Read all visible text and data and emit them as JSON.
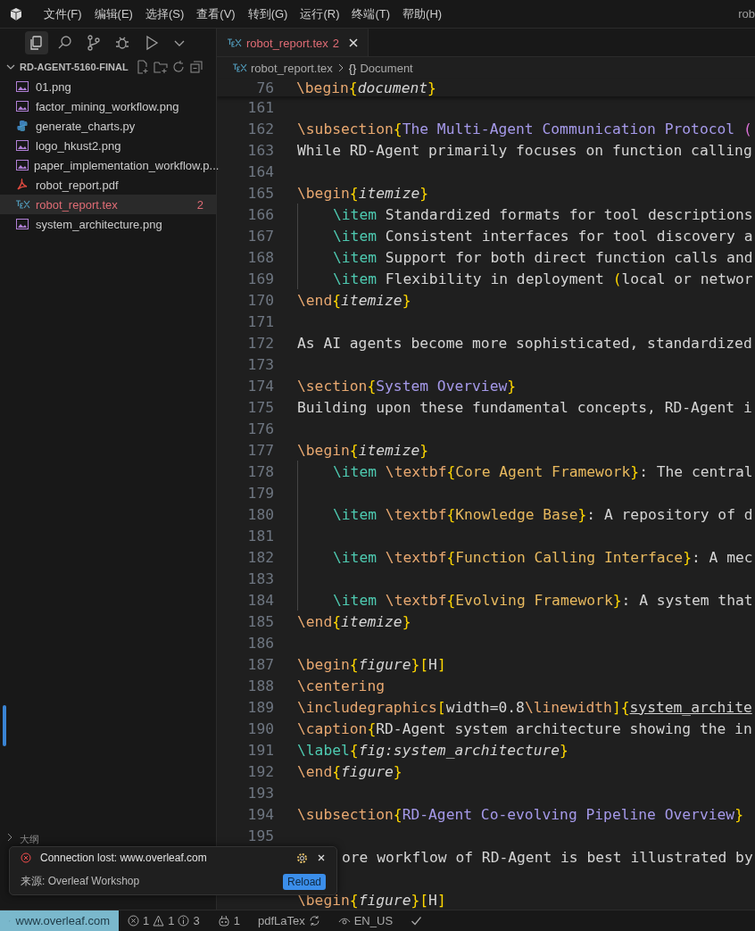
{
  "menu": [
    "文件(F)",
    "编辑(E)",
    "选择(S)",
    "查看(V)",
    "转到(G)",
    "运行(R)",
    "终端(T)",
    "帮助(H)"
  ],
  "window": {
    "title": "rob"
  },
  "activity": [
    {
      "kind": "explorer",
      "selected": true
    },
    {
      "kind": "search",
      "selected": false
    },
    {
      "kind": "source-control",
      "selected": false
    },
    {
      "kind": "debug",
      "selected": false
    },
    {
      "kind": "run",
      "selected": false
    },
    {
      "kind": "more",
      "selected": false
    }
  ],
  "explorer": {
    "folder": "RD-AGENT-5160-FINAL",
    "expanded": true,
    "files": [
      {
        "name": "01.png",
        "kind": "image",
        "selected": false,
        "error": false
      },
      {
        "name": "factor_mining_workflow.png",
        "kind": "image",
        "selected": false,
        "error": false
      },
      {
        "name": "generate_charts.py",
        "kind": "python",
        "selected": false,
        "error": false
      },
      {
        "name": "logo_hkust2.png",
        "kind": "image",
        "selected": false,
        "error": false
      },
      {
        "name": "paper_implementation_workflow.p...",
        "kind": "image",
        "selected": false,
        "error": false
      },
      {
        "name": "robot_report.pdf",
        "kind": "pdf",
        "selected": false,
        "error": false
      },
      {
        "name": "robot_report.tex",
        "kind": "tex",
        "selected": true,
        "error": true,
        "badge": "2"
      },
      {
        "name": "system_architecture.png",
        "kind": "image",
        "selected": false,
        "error": false
      }
    ],
    "outline": "大纲"
  },
  "tab": {
    "name": "robot_report.tex",
    "badge": "2",
    "selected": true,
    "error": true
  },
  "breadcrumb": {
    "file": "robot_report.tex",
    "symbol": "{}",
    "section": "Document"
  },
  "sticky_line": {
    "number": "76",
    "segments": [
      {
        "kind": "cmd",
        "text": "\\begin"
      },
      {
        "kind": "brace",
        "text": "{"
      },
      {
        "kind": "env",
        "text": "document"
      },
      {
        "kind": "brace",
        "text": "}"
      }
    ]
  },
  "lines": [
    {
      "number": "161",
      "indent": false
    },
    {
      "number": "162",
      "indent": false,
      "segments": [
        {
          "kind": "cmd",
          "text": "\\subsection"
        },
        {
          "kind": "brace",
          "text": "{"
        },
        {
          "kind": "title",
          "text": "The Multi-Agent Communication Protocol "
        },
        {
          "kind": "brace2",
          "text": "("
        }
      ]
    },
    {
      "number": "163",
      "indent": false,
      "segments": [
        {
          "kind": "text",
          "text": "While RD-Agent primarily focuses on function calling"
        }
      ]
    },
    {
      "number": "164",
      "indent": false
    },
    {
      "number": "165",
      "indent": false,
      "segments": [
        {
          "kind": "cmd",
          "text": "\\begin"
        },
        {
          "kind": "brace",
          "text": "{"
        },
        {
          "kind": "env",
          "text": "itemize"
        },
        {
          "kind": "brace",
          "text": "}"
        }
      ]
    },
    {
      "number": "166",
      "indent": true,
      "segments": [
        {
          "kind": "item",
          "text": "\\item"
        },
        {
          "kind": "text",
          "text": " Standardized formats for tool descriptions"
        }
      ]
    },
    {
      "number": "167",
      "indent": true,
      "segments": [
        {
          "kind": "item",
          "text": "\\item"
        },
        {
          "kind": "text",
          "text": " Consistent interfaces for tool discovery a"
        }
      ]
    },
    {
      "number": "168",
      "indent": true,
      "segments": [
        {
          "kind": "item",
          "text": "\\item"
        },
        {
          "kind": "text",
          "text": " Support for both direct function calls and"
        }
      ]
    },
    {
      "number": "169",
      "indent": true,
      "segments": [
        {
          "kind": "item",
          "text": "\\item"
        },
        {
          "kind": "text",
          "text": " Flexibility in deployment "
        },
        {
          "kind": "brace",
          "text": "("
        },
        {
          "kind": "text",
          "text": "local or networ"
        }
      ]
    },
    {
      "number": "170",
      "indent": false,
      "segments": [
        {
          "kind": "cmd",
          "text": "\\end"
        },
        {
          "kind": "brace",
          "text": "{"
        },
        {
          "kind": "env",
          "text": "itemize"
        },
        {
          "kind": "brace",
          "text": "}"
        }
      ]
    },
    {
      "number": "171",
      "indent": false
    },
    {
      "number": "172",
      "indent": false,
      "segments": [
        {
          "kind": "text",
          "text": "As AI agents become more sophisticated, standardized"
        }
      ]
    },
    {
      "number": "173",
      "indent": false
    },
    {
      "number": "174",
      "indent": false,
      "segments": [
        {
          "kind": "cmd",
          "text": "\\section"
        },
        {
          "kind": "brace",
          "text": "{"
        },
        {
          "kind": "title",
          "text": "System Overview"
        },
        {
          "kind": "brace",
          "text": "}"
        }
      ]
    },
    {
      "number": "175",
      "indent": false,
      "segments": [
        {
          "kind": "text",
          "text": "Building upon these fundamental concepts, RD-Agent i"
        }
      ]
    },
    {
      "number": "176",
      "indent": false
    },
    {
      "number": "177",
      "indent": false,
      "segments": [
        {
          "kind": "cmd",
          "text": "\\begin"
        },
        {
          "kind": "brace",
          "text": "{"
        },
        {
          "kind": "env",
          "text": "itemize"
        },
        {
          "kind": "brace",
          "text": "}"
        }
      ]
    },
    {
      "number": "178",
      "indent": true,
      "segments": [
        {
          "kind": "item",
          "text": "\\item "
        },
        {
          "kind": "cmd",
          "text": "\\textbf"
        },
        {
          "kind": "brace",
          "text": "{"
        },
        {
          "kind": "bold",
          "text": "Core Agent Framework"
        },
        {
          "kind": "brace",
          "text": "}"
        },
        {
          "kind": "text",
          "text": ": The central"
        }
      ]
    },
    {
      "number": "179",
      "indent": true
    },
    {
      "number": "180",
      "indent": true,
      "segments": [
        {
          "kind": "item",
          "text": "\\item "
        },
        {
          "kind": "cmd",
          "text": "\\textbf"
        },
        {
          "kind": "brace",
          "text": "{"
        },
        {
          "kind": "bold",
          "text": "Knowledge Base"
        },
        {
          "kind": "brace",
          "text": "}"
        },
        {
          "kind": "text",
          "text": ": A repository of d"
        }
      ]
    },
    {
      "number": "181",
      "indent": true
    },
    {
      "number": "182",
      "indent": true,
      "segments": [
        {
          "kind": "item",
          "text": "\\item "
        },
        {
          "kind": "cmd",
          "text": "\\textbf"
        },
        {
          "kind": "brace",
          "text": "{"
        },
        {
          "kind": "bold",
          "text": "Function Calling Interface"
        },
        {
          "kind": "brace",
          "text": "}"
        },
        {
          "kind": "text",
          "text": ": A mec"
        }
      ]
    },
    {
      "number": "183",
      "indent": true
    },
    {
      "number": "184",
      "indent": true,
      "segments": [
        {
          "kind": "item",
          "text": "\\item "
        },
        {
          "kind": "cmd",
          "text": "\\textbf"
        },
        {
          "kind": "brace",
          "text": "{"
        },
        {
          "kind": "bold",
          "text": "Evolving Framework"
        },
        {
          "kind": "brace",
          "text": "}"
        },
        {
          "kind": "text",
          "text": ": A system that"
        }
      ]
    },
    {
      "number": "185",
      "indent": false,
      "segments": [
        {
          "kind": "cmd",
          "text": "\\end"
        },
        {
          "kind": "brace",
          "text": "{"
        },
        {
          "kind": "env",
          "text": "itemize"
        },
        {
          "kind": "brace",
          "text": "}"
        }
      ]
    },
    {
      "number": "186",
      "indent": false
    },
    {
      "number": "187",
      "indent": false,
      "segments": [
        {
          "kind": "cmd",
          "text": "\\begin"
        },
        {
          "kind": "brace",
          "text": "{"
        },
        {
          "kind": "env",
          "text": "figure"
        },
        {
          "kind": "brace",
          "text": "}["
        },
        {
          "kind": "text",
          "text": "H"
        },
        {
          "kind": "brace",
          "text": "]"
        }
      ]
    },
    {
      "number": "188",
      "indent": false,
      "segments": [
        {
          "kind": "cmd",
          "text": "\\centering"
        }
      ]
    },
    {
      "number": "189",
      "indent": false,
      "segments": [
        {
          "kind": "cmd",
          "text": "\\includegraphics"
        },
        {
          "kind": "brace",
          "text": "["
        },
        {
          "kind": "text",
          "text": "width=0.8"
        },
        {
          "kind": "cmd",
          "text": "\\linewidth"
        },
        {
          "kind": "brace",
          "text": "]{"
        },
        {
          "kind": "path",
          "text": "system_archite"
        }
      ]
    },
    {
      "number": "190",
      "indent": false,
      "segments": [
        {
          "kind": "cmd",
          "text": "\\caption"
        },
        {
          "kind": "brace",
          "text": "{"
        },
        {
          "kind": "text",
          "text": "RD-Agent system architecture showing the in"
        }
      ]
    },
    {
      "number": "191",
      "indent": false,
      "segments": [
        {
          "kind": "item",
          "text": "\\label"
        },
        {
          "kind": "brace",
          "text": "{"
        },
        {
          "kind": "env",
          "text": "fig:system_architecture"
        },
        {
          "kind": "brace",
          "text": "}"
        }
      ]
    },
    {
      "number": "192",
      "indent": false,
      "segments": [
        {
          "kind": "cmd",
          "text": "\\end"
        },
        {
          "kind": "brace",
          "text": "{"
        },
        {
          "kind": "env",
          "text": "figure"
        },
        {
          "kind": "brace",
          "text": "}"
        }
      ]
    },
    {
      "number": "193",
      "indent": false
    },
    {
      "number": "194",
      "indent": false,
      "segments": [
        {
          "kind": "cmd",
          "text": "\\subsection"
        },
        {
          "kind": "brace",
          "text": "{"
        },
        {
          "kind": "title",
          "text": "RD-Agent Co-evolving Pipeline Overview"
        },
        {
          "kind": "brace",
          "text": "}"
        }
      ]
    },
    {
      "number": "195",
      "indent": false
    },
    {
      "indent": false,
      "clipped": true,
      "segments": [
        {
          "kind": "text",
          "text": "ore workflow of RD-Agent is best illustrated by"
        }
      ]
    },
    {
      "indent": false,
      "segments": [
        {
          "kind": "cmd",
          "text": "\\begin"
        },
        {
          "kind": "brace",
          "text": "{"
        },
        {
          "kind": "env",
          "text": "figure"
        },
        {
          "kind": "brace",
          "text": "}["
        },
        {
          "kind": "text",
          "text": "H"
        },
        {
          "kind": "brace",
          "text": "]"
        }
      ]
    }
  ],
  "notification": {
    "kind": "error",
    "message": "Connection lost: www.overleaf.com",
    "source": "来源: Overleaf Workshop",
    "action": "Reload"
  },
  "status_bar": {
    "remote": "www.overleaf.com",
    "errors": "1",
    "warnings": "1",
    "infos": "3",
    "copilot": "1",
    "compiler": "pdfLaTex",
    "language": "EN_US"
  }
}
